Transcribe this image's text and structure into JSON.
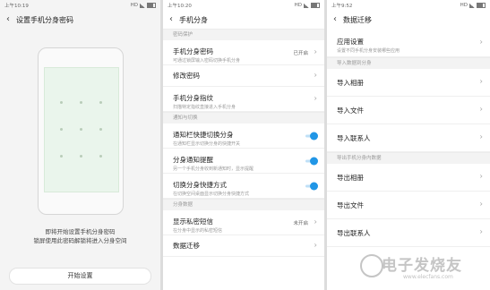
{
  "screen1": {
    "status_time": "上午10:19",
    "status_icons": "HD",
    "title": "设置手机分身密码",
    "prompt_line1": "即将开始设置手机分身密码",
    "prompt_line2": "锁屏使用此密码解锁将进入分身空间",
    "start_button": "开始设置"
  },
  "screen2": {
    "status_time": "上午10:20",
    "status_icons": "HD",
    "title": "手机分身",
    "section_password": "密码保护",
    "row_password_title": "手机分身密码",
    "row_password_sub": "可通过锁屏输入密码切换手机分身",
    "row_password_value": "已开启",
    "row_change_password": "修改密码",
    "row_fingerprint_title": "手机分身指纹",
    "row_fingerprint_sub": "扫描特定指纹直接进入手机分身",
    "section_notify": "通知与切换",
    "row_quickswitch_title": "通知栏快捷切换分身",
    "row_quickswitch_sub": "在通知栏显示切换分身的快捷开关",
    "row_notify_title": "分身通知提醒",
    "row_notify_sub": "另一个手机分身收到新通知时，显示提醒",
    "row_shortcut_title": "切换分身快捷方式",
    "row_shortcut_sub": "在切换空间桌面显示切换分身快捷方式",
    "section_data": "分身数据",
    "row_sms_title": "显示私密短信",
    "row_sms_sub": "在分身中显示的私密短信",
    "row_sms_value": "未开启",
    "row_migrate": "数据迁移"
  },
  "screen3": {
    "status_time": "上午9:52",
    "status_icons": "HD",
    "title": "数据迁移",
    "row_apps_title": "应用设置",
    "row_apps_sub": "设置不同手机分身安装哪些应用",
    "section_import": "导入数据到分身",
    "import_items": [
      "导入相册",
      "导入文件",
      "导入联系人"
    ],
    "section_export": "导出手机分身内数据",
    "export_items": [
      "导出相册",
      "导出文件",
      "导出联系人"
    ]
  },
  "watermark": {
    "text": "电子发烧友",
    "url": "www.elecfans.com"
  },
  "colors": {
    "accent": "#2196e6",
    "pattern_bg": "#eaf5ec"
  }
}
